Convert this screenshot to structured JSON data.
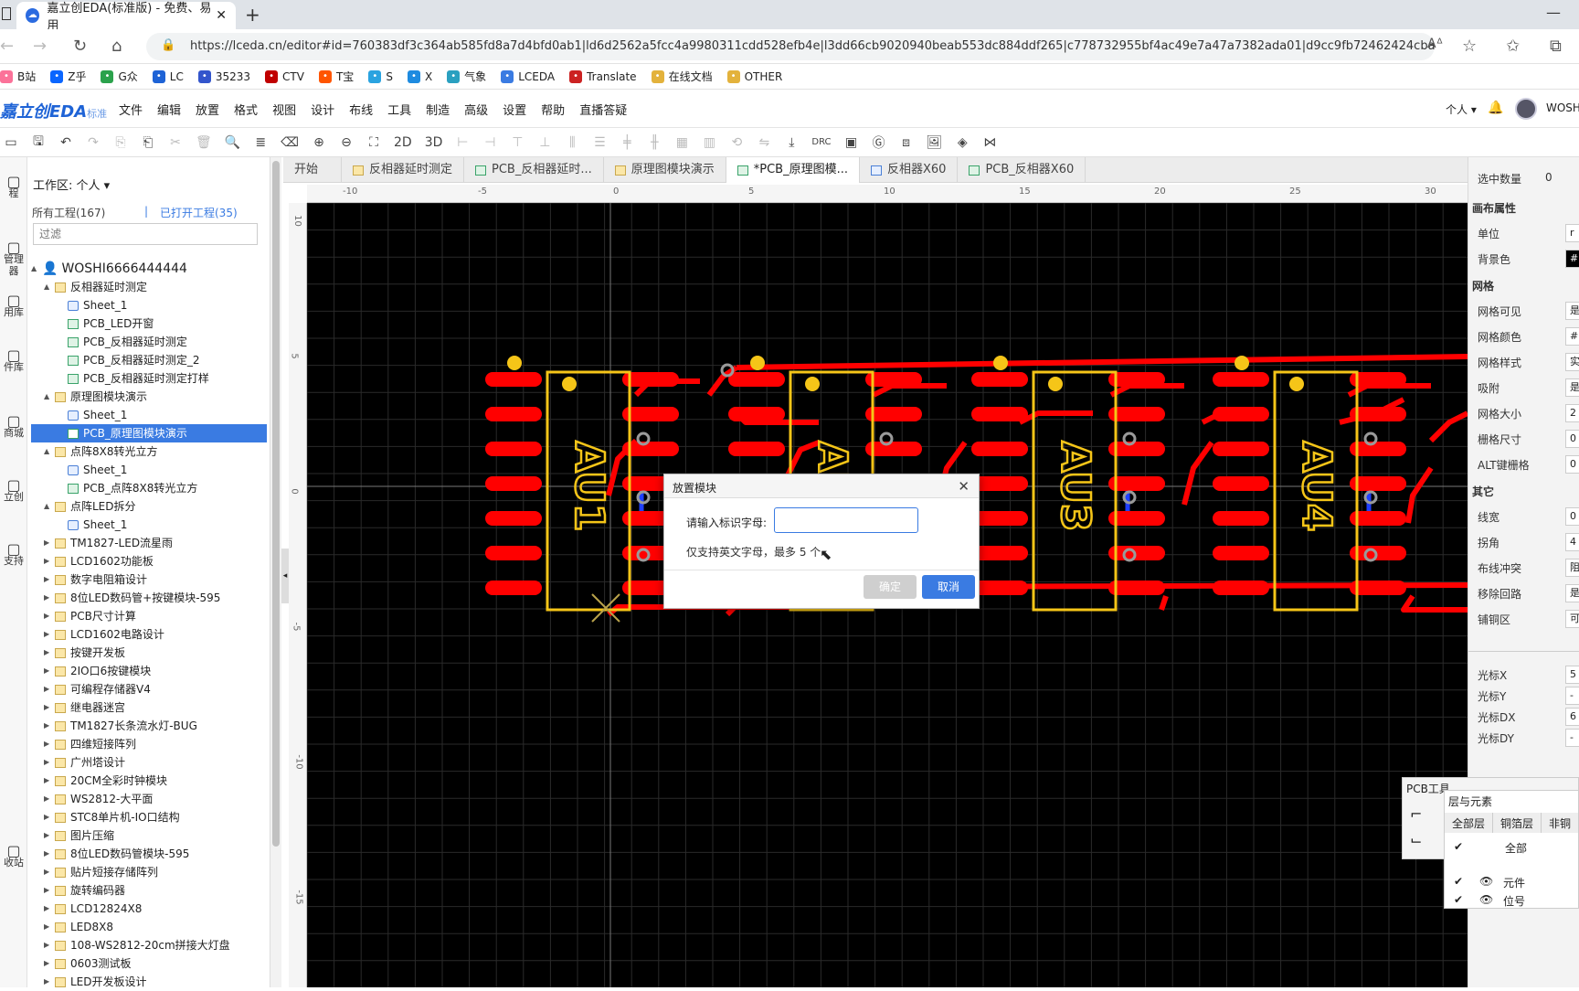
{
  "browser": {
    "tab_title": "嘉立创EDA(标准版) - 免费、易用",
    "url": "https://lceda.cn/editor#id=760383df3c364ab585fd8a7d4bfd0ab1|ld6d2562a5fcc4a9980311cdd528efb4e|l3dd66cb9020940beab553dc884ddf265|c778732955bf4ac49e7a47a7382ada01|d9cc9fb72462424cba89c388a3a...",
    "bookmarks": [
      {
        "label": "B站",
        "color": "#fb7299",
        "icon": "bilibili-icon"
      },
      {
        "label": "Z乎",
        "color": "#0a66ff",
        "icon": "zhihu-icon"
      },
      {
        "label": "G众",
        "color": "#2ba24c",
        "icon": "wechat-icon"
      },
      {
        "label": "LC",
        "color": "#1e63d6",
        "icon": "lc-icon"
      },
      {
        "label": "35233",
        "color": "#3355cc",
        "icon": "baidu-icon"
      },
      {
        "label": "CTV",
        "color": "#c00000",
        "icon": "cctv-icon"
      },
      {
        "label": "T宝",
        "color": "#ff5500",
        "icon": "taobao-icon"
      },
      {
        "label": "S",
        "color": "#2aa3e0",
        "icon": "check-icon"
      },
      {
        "label": "X",
        "color": "#1e8be0",
        "icon": "x-icon"
      },
      {
        "label": "气象",
        "color": "#2aa0c0",
        "icon": "weather-icon"
      },
      {
        "label": "LCEDA",
        "color": "#3a7be2",
        "icon": "lceda-icon"
      },
      {
        "label": "Translate",
        "color": "#cc2222",
        "icon": "translate-icon"
      },
      {
        "label": "在线文档",
        "color": "#e3b23c",
        "icon": "folder-icon"
      },
      {
        "label": "OTHER",
        "color": "#e3b23c",
        "icon": "folder-icon"
      }
    ]
  },
  "app": {
    "logo": "嘉立创EDA",
    "logo_sub": "标准",
    "menu": [
      "文件",
      "编辑",
      "放置",
      "格式",
      "视图",
      "设计",
      "布线",
      "工具",
      "制造",
      "高级",
      "设置",
      "帮助",
      "直播答疑"
    ],
    "user_scope": "个人",
    "username": "WOSH"
  },
  "toolbar": {
    "label_2d": "2D",
    "label_3d": "3D",
    "label_drc": "DRC"
  },
  "left_rail": [
    "程",
    "管理器",
    "用库",
    "件库",
    "商城",
    "立创",
    "支持",
    "收站"
  ],
  "project_panel": {
    "workspace": "工作区: 个人",
    "all_projects": "所有工程(167)",
    "separator": "|",
    "opened_projects": "已打开工程(35)",
    "filter_placeholder": "过滤",
    "tree": [
      {
        "label": "WOSHI6666444444",
        "kind": "user",
        "indent": 0,
        "arrow": "▲"
      },
      {
        "label": "反相器延时测定",
        "kind": "folder",
        "indent": 1,
        "arrow": "▲"
      },
      {
        "label": "Sheet_1",
        "kind": "sch",
        "indent": 2,
        "arrow": ""
      },
      {
        "label": "PCB_LED开窗",
        "kind": "pcb",
        "indent": 2,
        "arrow": ""
      },
      {
        "label": "PCB_反相器延时测定",
        "kind": "pcb",
        "indent": 2,
        "arrow": ""
      },
      {
        "label": "PCB_反相器延时测定_2",
        "kind": "pcb",
        "indent": 2,
        "arrow": ""
      },
      {
        "label": "PCB_反相器延时测定打样",
        "kind": "pcb",
        "indent": 2,
        "arrow": ""
      },
      {
        "label": "原理图模块演示",
        "kind": "folder",
        "indent": 1,
        "arrow": "▲"
      },
      {
        "label": "Sheet_1",
        "kind": "sch",
        "indent": 2,
        "arrow": ""
      },
      {
        "label": "PCB_原理图模块演示",
        "kind": "pcb",
        "indent": 2,
        "arrow": "",
        "selected": true
      },
      {
        "label": "点阵8X8转光立方",
        "kind": "folder",
        "indent": 1,
        "arrow": "▲"
      },
      {
        "label": "Sheet_1",
        "kind": "sch",
        "indent": 2,
        "arrow": ""
      },
      {
        "label": "PCB_点阵8X8转光立方",
        "kind": "pcb",
        "indent": 2,
        "arrow": ""
      },
      {
        "label": "点阵LED拆分",
        "kind": "folder",
        "indent": 1,
        "arrow": "▲"
      },
      {
        "label": "Sheet_1",
        "kind": "sch",
        "indent": 2,
        "arrow": ""
      },
      {
        "label": "TM1827-LED流星雨",
        "kind": "folder",
        "indent": 1,
        "arrow": "▶"
      },
      {
        "label": "LCD1602功能板",
        "kind": "folder",
        "indent": 1,
        "arrow": "▶"
      },
      {
        "label": "数字电阻箱设计",
        "kind": "folder",
        "indent": 1,
        "arrow": "▶"
      },
      {
        "label": "8位LED数码管+按键模块-595",
        "kind": "folder",
        "indent": 1,
        "arrow": "▶"
      },
      {
        "label": "PCB尺寸计算",
        "kind": "folder",
        "indent": 1,
        "arrow": "▶"
      },
      {
        "label": "LCD1602电路设计",
        "kind": "folder",
        "indent": 1,
        "arrow": "▶"
      },
      {
        "label": "按键开发板",
        "kind": "folder",
        "indent": 1,
        "arrow": "▶"
      },
      {
        "label": "2IO口6按键模块",
        "kind": "folder",
        "indent": 1,
        "arrow": "▶"
      },
      {
        "label": "可编程存储器V4",
        "kind": "folder",
        "indent": 1,
        "arrow": "▶"
      },
      {
        "label": "继电器迷宫",
        "kind": "folder",
        "indent": 1,
        "arrow": "▶"
      },
      {
        "label": "TM1827长条流水灯-BUG",
        "kind": "folder",
        "indent": 1,
        "arrow": "▶"
      },
      {
        "label": "四维短接阵列",
        "kind": "folder",
        "indent": 1,
        "arrow": "▶"
      },
      {
        "label": "广州塔设计",
        "kind": "folder",
        "indent": 1,
        "arrow": "▶"
      },
      {
        "label": "20CM全彩时钟模块",
        "kind": "folder",
        "indent": 1,
        "arrow": "▶"
      },
      {
        "label": "WS2812-大平面",
        "kind": "folder",
        "indent": 1,
        "arrow": "▶"
      },
      {
        "label": "STC8单片机-IO口结构",
        "kind": "folder",
        "indent": 1,
        "arrow": "▶"
      },
      {
        "label": "图片压缩",
        "kind": "folder",
        "indent": 1,
        "arrow": "▶"
      },
      {
        "label": "8位LED数码管模块-595",
        "kind": "folder",
        "indent": 1,
        "arrow": "▶"
      },
      {
        "label": "贴片短接存储阵列",
        "kind": "folder",
        "indent": 1,
        "arrow": "▶"
      },
      {
        "label": "旋转编码器",
        "kind": "folder",
        "indent": 1,
        "arrow": "▶"
      },
      {
        "label": "LCD12824X8",
        "kind": "folder",
        "indent": 1,
        "arrow": "▶"
      },
      {
        "label": "LED8X8",
        "kind": "folder",
        "indent": 1,
        "arrow": "▶"
      },
      {
        "label": "108-WS2812-20cm拼接大灯盘",
        "kind": "folder",
        "indent": 1,
        "arrow": "▶"
      },
      {
        "label": "0603测试板",
        "kind": "folder",
        "indent": 1,
        "arrow": "▶"
      },
      {
        "label": "LED开发板设计",
        "kind": "folder",
        "indent": 1,
        "arrow": "▶"
      }
    ]
  },
  "doc_tabs": [
    {
      "label": "开始",
      "kind": "none"
    },
    {
      "label": "反相器延时测定",
      "kind": "folder"
    },
    {
      "label": "PCB_反相器延时...",
      "kind": "pcb"
    },
    {
      "label": "原理图模块演示",
      "kind": "folder"
    },
    {
      "label": "*PCB_原理图模...",
      "kind": "pcb",
      "active": true
    },
    {
      "label": "反相器X60",
      "kind": "sch"
    },
    {
      "label": "PCB_反相器X60",
      "kind": "pcb"
    }
  ],
  "ruler_top": [
    "-10",
    "-5",
    "0",
    "5",
    "10",
    "15",
    "20",
    "25",
    "30"
  ],
  "ruler_left": [
    "10",
    "5",
    "0",
    "-5",
    "-10",
    "-15"
  ],
  "pcb": {
    "background": "#000000",
    "pad_color": "#ff0000",
    "silk_color": "#f5c518",
    "via_color": "#9a9a9a",
    "modules": [
      "AU1",
      "AU2",
      "AU3",
      "AU4"
    ]
  },
  "dialog": {
    "title": "放置模块",
    "label": "请输入标识字母:",
    "value": "",
    "hint": "仅支持英文字母，最多 5 个",
    "ok": "确定",
    "cancel": "取消"
  },
  "right_panel": {
    "selected_count_label": "选中数量",
    "selected_count": "0",
    "canvas_props": "画布属性",
    "unit": "单位",
    "bg": "背景色",
    "grid_head": "网格",
    "grid_visible": "网格可见",
    "grid_color": "网格颜色",
    "grid_style": "网格样式",
    "snap": "吸附",
    "grid_size": "网格大小",
    "snap_size": "栅格尺寸",
    "alt_snap": "ALT键栅格",
    "other_head": "其它",
    "line_width": "线宽",
    "corner": "拐角",
    "route_conflict": "布线冲突",
    "remove_loop": "移除回路",
    "copper": "铺铜区",
    "cursor_x": "光标X",
    "cursor_y": "光标Y",
    "cursor_dx": "光标DX",
    "cursor_dy": "光标DY",
    "val_unit": "r",
    "val_bg": "#",
    "val_visible": "是",
    "val_grid_color": "#",
    "val_style": "实",
    "val_snap": "是",
    "val_grid_size": "2",
    "val_snap_size": "0",
    "val_alt": "0",
    "val_lw": "0",
    "val_corner": "4",
    "val_conflict": "阻",
    "val_loop": "是",
    "val_copper": "可",
    "val_cx": "5",
    "val_cy": "-",
    "val_cdx": "6",
    "val_cdy": "-"
  },
  "pcb_tools": {
    "title": "PCB工具",
    "layers_title": "层与元素",
    "tabs": [
      "全部层",
      "铜箔层",
      "非铜"
    ],
    "all": "全部",
    "components": "元件",
    "position": "位号"
  }
}
